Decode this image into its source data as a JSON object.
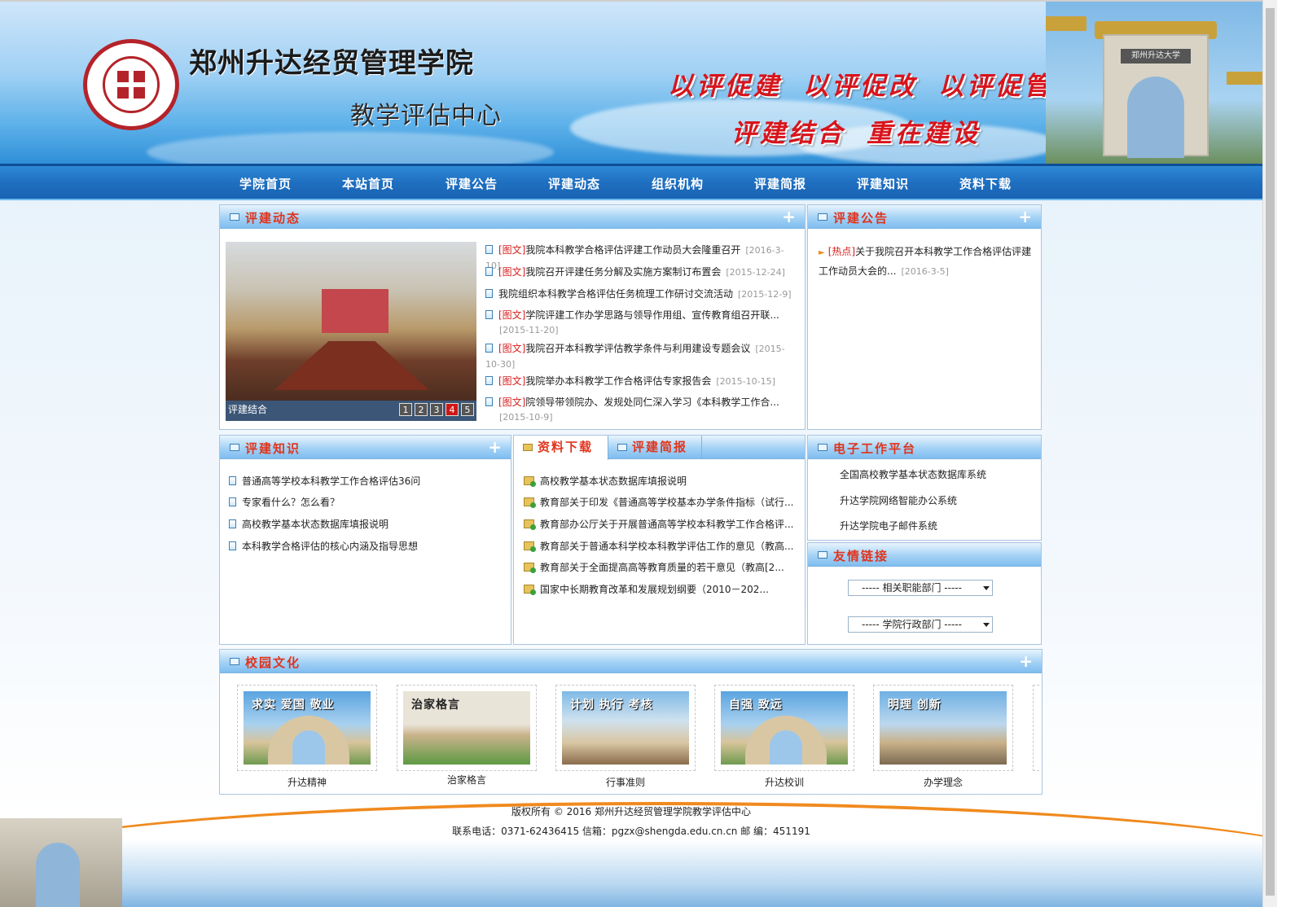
{
  "header": {
    "site_title": "郑州升达经贸管理学院",
    "site_subtitle": "教学评估中心",
    "slogans": [
      "以评促建",
      "以评促改",
      "以评促管",
      "评建结合",
      "重在建设"
    ],
    "gate_plate": "郑州升达大学"
  },
  "nav": {
    "items": [
      "学院首页",
      "本站首页",
      "评建公告",
      "评建动态",
      "组织机构",
      "评建简报",
      "评建知识",
      "资料下载"
    ]
  },
  "news_panel": {
    "title": "评建动态",
    "more": "+",
    "slider": {
      "caption": "评建结合",
      "pages": [
        "1",
        "2",
        "3",
        "4",
        "5"
      ],
      "active_page": "4"
    },
    "items": [
      {
        "tag": "[图文]",
        "text": "我院本科教学合格评估评建工作动员大会隆重召开",
        "date": "[2016-3-10]"
      },
      {
        "tag": "[图文]",
        "text": "我院召开评建任务分解及实施方案制订布置会",
        "date": "[2015-12-24]"
      },
      {
        "tag": "",
        "text": "我院组织本科教学合格评估任务梳理工作研讨交流活动",
        "date": "[2015-12-9]"
      },
      {
        "tag": "[图文]",
        "text": "学院评建工作办学思路与领导作用组、宣传教育组召开联...",
        "date": "[2015-11-20]"
      },
      {
        "tag": "[图文]",
        "text": "我院召开本科教学评估教学条件与利用建设专题会议",
        "date": "[2015-10-30]"
      },
      {
        "tag": "[图文]",
        "text": "我院举办本科教学工作合格评估专家报告会",
        "date": "[2015-10-15]"
      },
      {
        "tag": "[图文]",
        "text": "院领导带领院办、发规处同仁深入学习《本科教学工作合...",
        "date": "[2015-10-9]"
      }
    ]
  },
  "notice_panel": {
    "title": "评建公告",
    "more": "+",
    "items": [
      {
        "tag": "[热点]",
        "text": "关于我院召开本科教学工作合格评估评建工作动员大会的...",
        "date": "[2016-3-5]"
      }
    ]
  },
  "knowledge_panel": {
    "title": "评建知识",
    "more": "+",
    "items": [
      "普通高等学校本科教学工作合格评估36问",
      "专家看什么？怎么看？",
      "高校教学基本状态数据库填报说明",
      "本科教学合格评估的核心内涵及指导思想"
    ]
  },
  "download_panel": {
    "tabs": [
      "资料下载",
      "评建简报"
    ],
    "items": [
      "高校教学基本状态数据库填报说明",
      "教育部关于印发《普通高等学校基本办学条件指标（试行...",
      "教育部办公厅关于开展普通高等学校本科教学工作合格评...",
      "教育部关于普通本科学校本科教学评估工作的意见（教高...",
      "教育部关于全面提高高等教育质量的若干意见（教高[2...",
      "国家中长期教育改革和发展规划纲要（2010－202..."
    ]
  },
  "platform_panel": {
    "title": "电子工作平台",
    "items": [
      "全国高校教学基本状态数据库系统",
      "升达学院网络智能办公系统",
      "升达学院电子邮件系统"
    ]
  },
  "links_panel": {
    "title": "友情链接",
    "selects": [
      "-----  相关职能部门  -----",
      "-----  学院行政部门  -----"
    ]
  },
  "culture_panel": {
    "title": "校园文化",
    "more": "+",
    "items": [
      {
        "label": "升达精神",
        "img_text": "求实 爱国 敬业"
      },
      {
        "label": "治家格言",
        "img_text": "治家格言"
      },
      {
        "label": "行事准则",
        "img_text": "计划 执行 考核"
      },
      {
        "label": "升达校训",
        "img_text": "自强 致远"
      },
      {
        "label": "办学理念",
        "img_text": "明理 创新"
      }
    ]
  },
  "footer": {
    "line1": "版权所有   © 2016   郑州升达经贸管理学院教学评估中心",
    "line2": "联系电话：0371-62436415   信箱：pgzx@shengda.edu.cn.cn   邮  编：451191"
  },
  "colors": {
    "nav_blue": "#1f6fc0",
    "title_red": "#e0341d",
    "tag_red": "#d81e1e",
    "slogan_red": "#d8141c",
    "accent_orange": "#f08a1e"
  }
}
